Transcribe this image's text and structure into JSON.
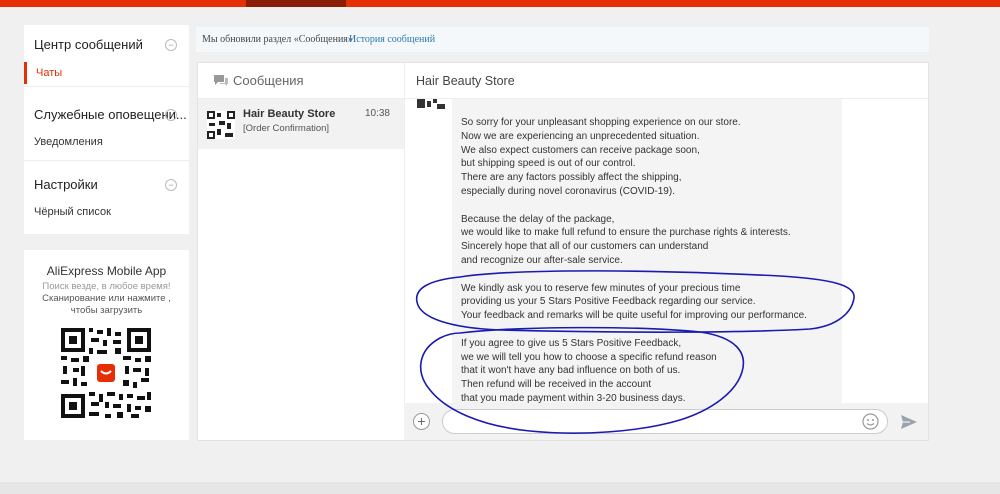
{
  "sidebar": {
    "sections": [
      {
        "title": "Центр сообщений",
        "links": [
          "Чаты"
        ]
      },
      {
        "title": "Служебные оповещени...",
        "links": [
          "Уведомления"
        ]
      },
      {
        "title": "Настройки",
        "links": [
          "Чёрный список"
        ]
      }
    ],
    "toggle_symbol": "−"
  },
  "app_promo": {
    "title": "AliExpress Mobile App",
    "line1": "Поиск везде, в любое время!",
    "line2": "Сканирование или нажмите ,",
    "line3": "чтобы загрузить"
  },
  "notice": {
    "text": "Мы обновили раздел «Сообщения»!",
    "link": "История сообщений"
  },
  "conversations": {
    "header": "Сообщения",
    "items": [
      {
        "name": "Hair Beauty Store",
        "subtitle": "[Order Confirmation]",
        "time": "10:38"
      }
    ]
  },
  "chat": {
    "title": "Hair Beauty Store",
    "message_lines": [
      "So sorry for your unpleasant shopping experience on our store.",
      "Now we are experiencing an unprecedented situation.",
      "We also expect customers can receive package soon,",
      "but shipping speed is out of our control.",
      "There are any factors possibly affect the shipping,",
      "especially during novel coronavirus (COVID-19).",
      "",
      "Because the delay of the package,",
      "we would like to make full refund to ensure the purchase rights & interests.",
      "Sincerely hope that all of our customers can understand",
      "and recognize our after-sale service.",
      "",
      "We kindly ask you to reserve few minutes of your precious time",
      "providing us your 5 Stars Positive Feedback regarding our service.",
      "Your feedback and remarks will be quite useful for improving our performance.",
      "",
      "If you agree to give us 5 Stars Positive Feedback,",
      "we we will tell you how to choose a specific refund reason",
      "that it won't have any bad influence on both of us.",
      "Then refund will be received in the account",
      "that you made payment within 3-20 business days."
    ],
    "input_placeholder": "",
    "plus_symbol": "+"
  },
  "colors": {
    "brand": "#e62e04",
    "link": "#2a7ab0",
    "annotation": "#1a1ab0"
  },
  "icons": [
    "chat-bubble-icon",
    "plus-icon",
    "emoji-icon",
    "send-icon",
    "qr-code-icon"
  ]
}
